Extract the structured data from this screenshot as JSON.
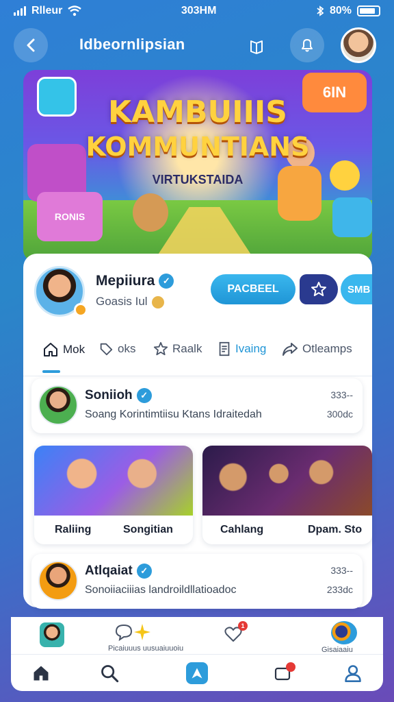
{
  "status_bar": {
    "carrier": "Rlleur",
    "time": "303HM",
    "battery": "80%"
  },
  "header": {
    "title": "Idbeornlipsian",
    "back_icon": "chevron-left-icon",
    "book_icon": "book-icon",
    "bell_icon": "bell-icon"
  },
  "banner": {
    "title_line1": "KAMBUIIIS",
    "title_line2": "KOMMUNTIANS",
    "subtitle": "VIRTUKSTAIDA",
    "box_label": "RONIS",
    "sign_label": "6IN"
  },
  "profile": {
    "name": "Mepiiura",
    "subtitle": "Goasis Iul",
    "follow_label": "PACBEEL",
    "more_label": "SMB"
  },
  "tabs": [
    {
      "label": "Mok",
      "icon": "home-icon"
    },
    {
      "label": "oks",
      "icon": "tag-icon"
    },
    {
      "label": "Raalk",
      "icon": "star-icon"
    },
    {
      "label": "Ivaing",
      "icon": "document-icon"
    },
    {
      "label": "Otleamps",
      "icon": "share-icon"
    }
  ],
  "posts": [
    {
      "name": "Soniioh",
      "text": "Soang Korintimtiisu Ktans Idraitedah",
      "meta1": "333--",
      "meta2": "300dc"
    },
    {
      "name": "Atlqaiat",
      "text": "Sonoiiaciiias landroildllatioadoc",
      "meta1": "333--",
      "meta2": "233dc"
    }
  ],
  "media": [
    {
      "caption_left": "Raliing",
      "caption_right": "Songitian"
    },
    {
      "caption_left": "Cahlang",
      "caption_right": "Dpam. Sto"
    }
  ],
  "bottom_nav": {
    "top_caption": "Picaiuuus uusuaiuuoiu",
    "notification_count": "1",
    "right_caption": "Gisaiaaiu"
  },
  "colors": {
    "accent": "#2d9cdb",
    "dark_button": "#2a3a8f",
    "gold": "#ffd23f"
  }
}
